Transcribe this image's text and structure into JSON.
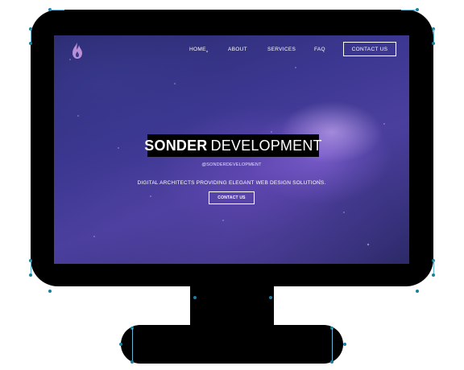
{
  "site": {
    "nav": {
      "home": "HOME",
      "about": "ABOUT",
      "services": "SERVICES",
      "faq": "FAQ",
      "contact": "CONTACT US"
    },
    "hero": {
      "title_bold": "SONDER",
      "title_light": "DEVELOPMENT",
      "handle": "@SONDERDEVELOPMENT",
      "tagline": "DIGITAL ARCHITECTS PROVIDING ELEGANT WEB DESIGN SOLUTIONS.",
      "cta": "CONTACT US"
    }
  },
  "icons": {
    "logo": "flame-drop-icon"
  },
  "colors": {
    "bezel": "#000000",
    "sky_dark": "#2a2b6e",
    "sky_mid": "#4b3f9e",
    "nebula": "#dcbfff",
    "selection_anchor": "#1b7fa3"
  }
}
